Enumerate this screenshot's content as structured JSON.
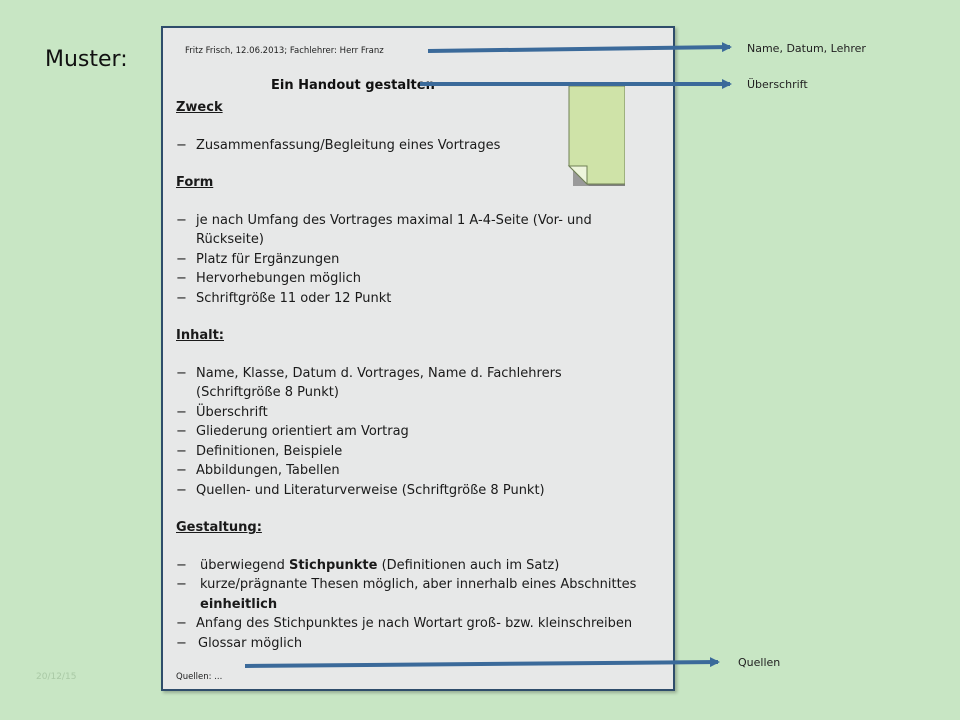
{
  "slide": {
    "title": "Muster:",
    "slide_number": "20/12/15"
  },
  "document": {
    "header_line": "Fritz Frisch, 12.06.2013; Fachlehrer: Herr Franz",
    "title": "Ein Handout gestalten",
    "sections": {
      "zweck": {
        "heading": "Zweck",
        "items": [
          "Zusammenfassung/Begleitung eines Vortrages"
        ]
      },
      "form": {
        "heading": "Form",
        "items": [
          "je nach Umfang des Vortrages maximal 1 A-4-Seite (Vor- und",
          "Rückseite)",
          "Platz für Ergänzungen",
          "Hervorhebungen möglich",
          "Schriftgröße 11 oder 12 Punkt"
        ]
      },
      "inhalt": {
        "heading": "Inhalt:",
        "items": [
          "Name, Klasse, Datum d. Vortrages, Name d. Fachlehrers",
          "(Schriftgröße 8 Punkt)",
          "Überschrift",
          "Gliederung orientiert am Vortrag",
          "Definitionen, Beispiele",
          "Abbildungen, Tabellen",
          "Quellen- und Literaturverweise (Schriftgröße 8 Punkt)"
        ]
      },
      "gestaltung": {
        "heading": "Gestaltung:",
        "item1_pre": "überwiegend ",
        "item1_bold": "Stichpunkte",
        "item1_post": " (Definitionen auch im Satz)",
        "item2_line1": "kurze/prägnante Thesen möglich, aber innerhalb eines Abschnittes",
        "item2_line2": "einheitlich",
        "item3": "Anfang des Stichpunktes  je nach Wortart groß- bzw. kleinschreiben",
        "item4": "Glossar möglich"
      }
    },
    "sources": "Quellen: ..."
  },
  "annotations": {
    "name_date_teacher": "Name,  Datum,  Lehrer",
    "heading": "Überschrift",
    "sources": "Quellen"
  },
  "dash": "−",
  "colors": {
    "background": "#c8e6c4",
    "page": "#e7e8e8",
    "arrow": "#3b6a9a",
    "note": "#cfe3a8"
  }
}
